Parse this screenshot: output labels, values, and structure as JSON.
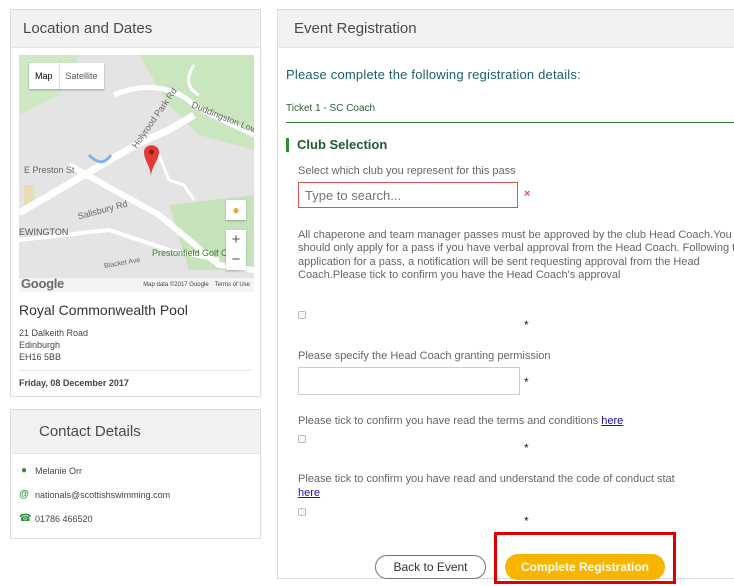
{
  "location_panel": {
    "title": "Location and Dates",
    "map": {
      "type_map": "Map",
      "type_satellite": "Satellite",
      "labels": [
        "E Preston St",
        "Salisbury Rd",
        "EWINGTON",
        "Prestonfield Golf C",
        "Duddingston Low Rd",
        "Holyrood Park Rd",
        "Blacket Ave"
      ],
      "zoom_in": "+",
      "zoom_out": "−",
      "logo": "Google",
      "map_data": "Map data ©2017 Google",
      "terms": "Terms of Use"
    },
    "venue_name": "Royal Commonwealth Pool",
    "address_lines": [
      "21 Dalkeith Road",
      "Edinburgh",
      "EH16 5BB"
    ],
    "date": "Friday, 08 December 2017"
  },
  "contact_panel": {
    "title": "Contact Details",
    "name": "Melanie Orr",
    "email": "nationals@scottishswimming.com",
    "phone": "01786 466520"
  },
  "registration_panel": {
    "title": "Event Registration",
    "intro": "Please complete the following registration details:",
    "ticket": "Ticket 1 - SC Coach",
    "section_title": "Club Selection",
    "club_question": "Select which club you represent for this pass",
    "club_placeholder": "Type to search...",
    "clear_icon": "×",
    "approval_paragraph": "All chaperone and team manager passes must be approved by the club Head Coach.You should only apply for a pass if you have verbal approval from the Head Coach. Following the application for a pass, a notification will be sent requesting approval from the Head Coach.Please tick to confirm you have the Head Coach's approval",
    "required_mark": "*",
    "head_coach_question": "Please specify the Head Coach granting permission",
    "terms_question": "Please tick to confirm you have read the terms and conditions ",
    "terms_link": "here",
    "conduct_question": "Please tick to confirm you have read and understand the code of conduct stat",
    "conduct_link": "here",
    "back_button": "Back to Event",
    "complete_button": "Complete Registration"
  },
  "colors": {
    "accent_green": "#2e8b3d",
    "button_yellow": "#f7b500",
    "error_red": "#d9534f",
    "highlight_red": "#e00000",
    "link_blue": "#1a0dab"
  }
}
